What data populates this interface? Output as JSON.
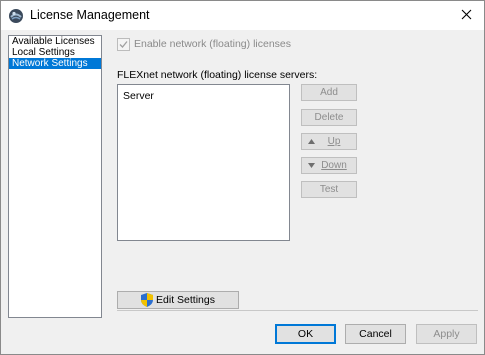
{
  "window": {
    "title": "License Management",
    "close_glyph": "✕"
  },
  "sidebar": {
    "items": [
      {
        "label": "Available Licenses",
        "selected": false
      },
      {
        "label": "Local Settings",
        "selected": false
      },
      {
        "label": "Network Settings",
        "selected": true
      }
    ]
  },
  "network": {
    "enable_checkbox_label": "Enable network (floating) licenses",
    "enable_checked": true,
    "enable_disabled": true,
    "servers_label": "FLEXnet network (floating) license servers:",
    "servers": [
      {
        "name": "Server"
      }
    ],
    "buttons": {
      "add": "Add",
      "delete": "Delete",
      "up": "Up",
      "down": "Down",
      "test": "Test"
    },
    "edit_settings": "Edit Settings"
  },
  "footer": {
    "ok": "OK",
    "cancel": "Cancel",
    "apply": "Apply"
  },
  "colors": {
    "accent": "#0078d7",
    "disabled_text": "#8d8d8d",
    "shield_blue": "#2b6fd0",
    "shield_yellow": "#f2c200"
  },
  "icons": {
    "app": "license-globe-icon",
    "close": "close-icon",
    "checkbox": "checkmark-icon",
    "up": "triangle-up-icon",
    "down": "triangle-down-icon",
    "edit": "uac-shield-icon"
  }
}
